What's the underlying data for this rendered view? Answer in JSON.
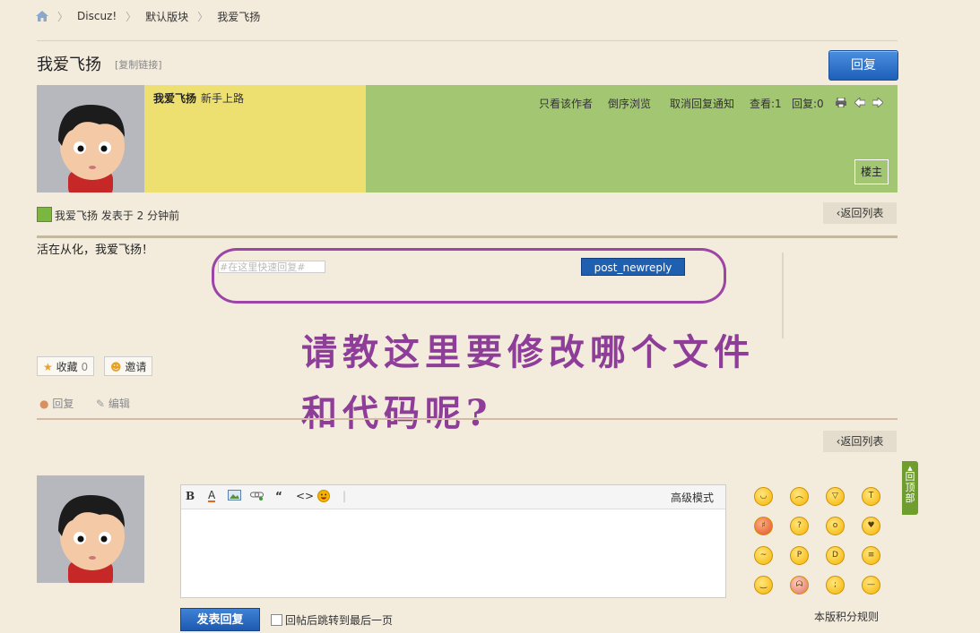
{
  "breadcrumb": {
    "home_icon": "home-icon",
    "items": [
      "Discuz!",
      "默认版块",
      "我爱飞扬"
    ]
  },
  "thread": {
    "title": "我爱飞扬",
    "copy_link": "[复制链接]",
    "reply_button": "回复"
  },
  "post": {
    "author": "我爱飞扬",
    "rank": "新手上路",
    "links": [
      "只看该作者",
      "倒序浏览",
      "取消回复通知",
      "查看:1",
      "回复:0"
    ],
    "floor": "楼主",
    "meta": "我爱飞扬 发表于 2 分钟前",
    "back_to_list": "返回列表",
    "content": "活在从化，我爱飞扬！",
    "quick_reply_placeholder": "#在这里快速回复#",
    "quick_reply_submit": "post_newreply",
    "annotation": "请教这里要修改哪个文件和代码呢?",
    "favorite": "收藏",
    "favorite_count": "0",
    "invite": "邀请",
    "reply_link": "回复",
    "edit_link": "编辑"
  },
  "back_to_list_2": "返回列表",
  "to_top": "回顶部",
  "editor": {
    "toolbar": [
      "B",
      "A",
      "image-icon",
      "link-icon",
      "quote-icon",
      "code-icon",
      "smiley-icon"
    ],
    "advanced_mode": "高级模式",
    "submit": "发表回复",
    "jump_label": "回帖后跳转到最后一页",
    "rules": "本版积分规则"
  },
  "colors": {
    "accent_blue": "#1e5fb8",
    "annotation_purple": "#8e3d99",
    "user_box": "#ede071",
    "header_green": "#a3c672"
  }
}
